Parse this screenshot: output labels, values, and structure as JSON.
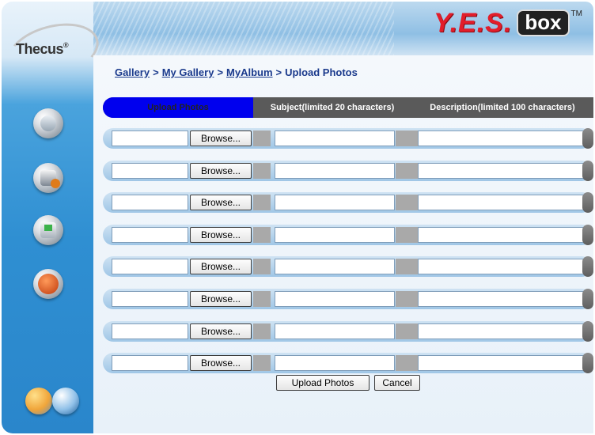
{
  "brand": {
    "logo_text": "Thecus",
    "logo_reg": "®",
    "product_yes": "Y.E.S.",
    "product_box": "box",
    "product_tm": "TM"
  },
  "breadcrumb": {
    "items": [
      "Gallery",
      "My Gallery",
      "MyAlbum"
    ],
    "current": "Upload Photos",
    "separator": ">"
  },
  "table": {
    "headers": {
      "upload": "Upload Photos",
      "subject": "Subject(limited 20 characters)",
      "description": "Description(limited 100 characters)"
    },
    "browse_label": "Browse...",
    "row_count": 8
  },
  "actions": {
    "upload_label": "Upload Photos",
    "cancel_label": "Cancel"
  },
  "sidebar": {
    "icons": [
      "disk-icon",
      "printer-icon",
      "monitor-icon",
      "home-icon"
    ],
    "bottom_icons": [
      "language-icon",
      "logout-icon"
    ]
  },
  "colors": {
    "active_header": "#0000ee",
    "header_dark": "#5a5a5a",
    "brand_red": "#e21d2a",
    "link": "#1a3a8c"
  }
}
